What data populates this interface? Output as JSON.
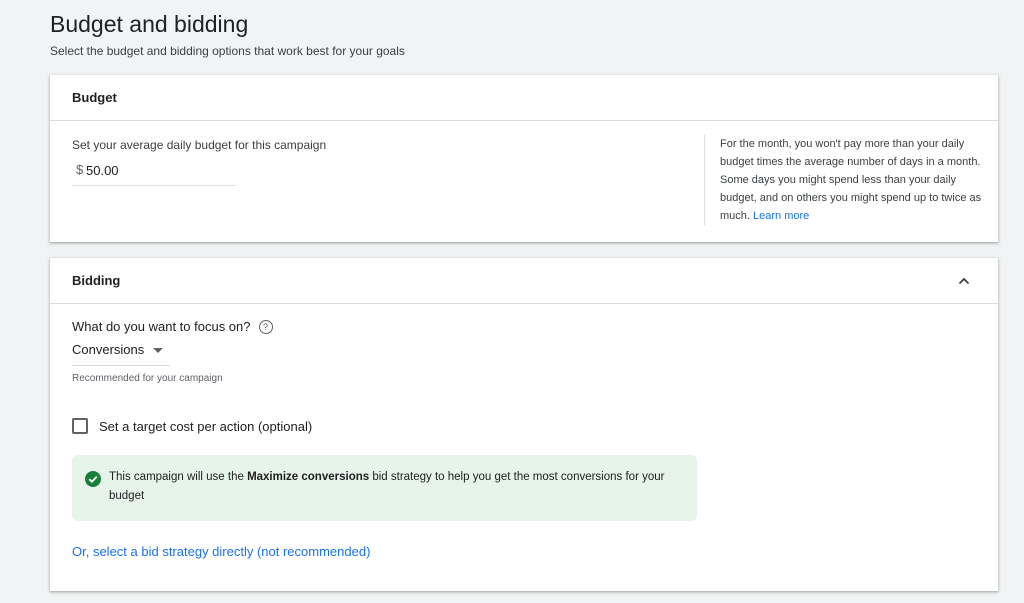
{
  "page": {
    "title": "Budget and bidding",
    "subtitle": "Select the budget and bidding options that work best for your goals"
  },
  "budget": {
    "title": "Budget",
    "label": "Set your average daily budget for this campaign",
    "currency": "$",
    "amount": "50.00",
    "note": "For the month, you won't pay more than your daily budget times the average number of days in a month. Some days you might spend less than your daily budget, and on others you might spend up to twice as much.",
    "learn_more": "Learn more"
  },
  "bidding": {
    "title": "Bidding",
    "collapse_icon": "chevron-up-icon",
    "focus_question": "What do you want to focus on?",
    "help_icon": "help-icon",
    "help_glyph": "?",
    "focus_value": "Conversions",
    "recommended": "Recommended for your campaign",
    "target_cpa_label": "Set a target cost per action (optional)",
    "target_cpa_checked": false,
    "info": {
      "prefix": "This campaign will use the ",
      "strategy": "Maximize conversions",
      "suffix": " bid strategy to help you get the most conversions for your budget",
      "icon": "check-circle-icon",
      "icon_color": "#188038",
      "background": "#e6f4ea"
    },
    "bid_strategy_link": "Or, select a bid strategy directly (not recommended)"
  },
  "colors": {
    "link": "#1a73e8",
    "page_background": "#f1f3f4"
  }
}
